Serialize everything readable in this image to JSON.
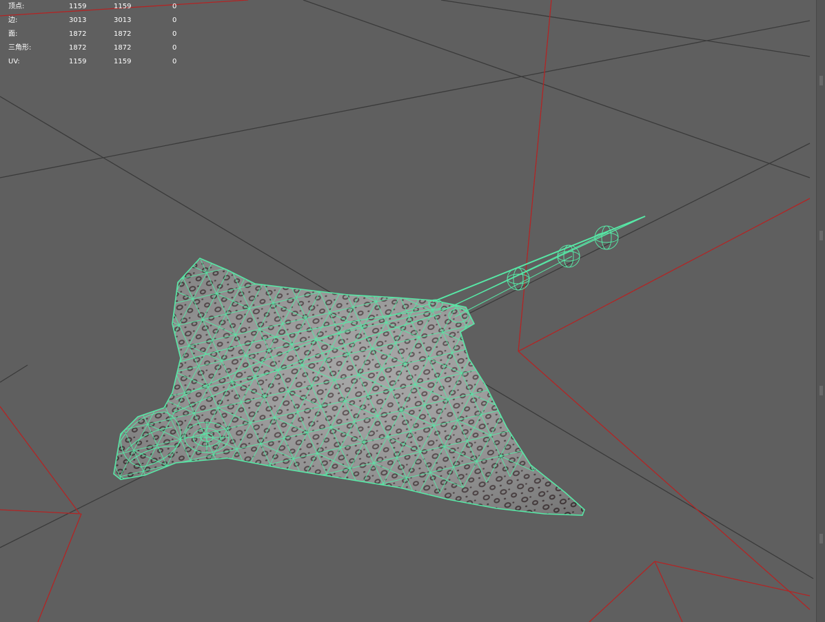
{
  "app": "Maya viewport",
  "colors": {
    "background": "#5f5f5f",
    "grid": "#3c3c3c",
    "axis": "#b32424",
    "wireframe": "#57e8a6",
    "skin": "#9a9a9a",
    "spots": "#4a3f40"
  },
  "heads_up_display": {
    "stats": [
      {
        "label": "顶点:",
        "v1": "1159",
        "v2": "1159",
        "v3": "0"
      },
      {
        "label": "边:",
        "v1": "3013",
        "v2": "3013",
        "v3": "0"
      },
      {
        "label": "面:",
        "v1": "1872",
        "v2": "1872",
        "v3": "0"
      },
      {
        "label": "三角形:",
        "v1": "1872",
        "v2": "1872",
        "v3": "0"
      },
      {
        "label": "UV:",
        "v1": "1159",
        "v2": "1159",
        "v3": "0"
      }
    ]
  },
  "scene": {
    "object": "stingray mesh",
    "display_mode": "wireframe on shaded"
  }
}
